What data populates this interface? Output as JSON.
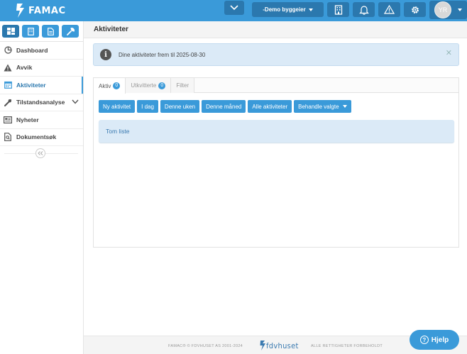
{
  "header": {
    "logo_text": "FAMAC",
    "tenant_label": "-Demo byggeier",
    "user_initials": "YR"
  },
  "sidebar": {
    "tabs": [
      "dashboard-grid-icon",
      "building-icon",
      "document-icon",
      "wrench-icon"
    ],
    "items": [
      {
        "label": "Dashboard",
        "icon": "pie-chart-icon"
      },
      {
        "label": "Avvik",
        "icon": "warning-icon"
      },
      {
        "label": "Aktiviteter",
        "icon": "calendar-icon",
        "active": true
      },
      {
        "label": "Tilstandsanalyse",
        "icon": "wrench-icon",
        "expandable": true
      },
      {
        "label": "Nyheter",
        "icon": "newspaper-icon"
      },
      {
        "label": "Dokumentsøk",
        "icon": "file-search-icon"
      }
    ]
  },
  "main": {
    "page_title": "Aktiviteter",
    "alert_text": "Dine aktiviteter frem til 2025-08-30",
    "tabs": [
      {
        "label": "Aktiv",
        "badge": "0"
      },
      {
        "label": "Utkvitterte",
        "badge": "0"
      },
      {
        "label": "Filter",
        "badge": ""
      }
    ],
    "buttons": {
      "new_activity": "Ny aktivitet",
      "today": "I dag",
      "this_week": "Denne uken",
      "this_month": "Denne måned",
      "all_activities": "Alle aktiviteter",
      "handle_selected": "Behandle valgte"
    },
    "empty_text": "Tom liste"
  },
  "footer": {
    "left_text": "FAMAC® © FDVHUSET AS 2001-2024",
    "logo_text": "fdvhuset",
    "right_text": "ALLE RETTIGHETER FORBEHOLDT"
  },
  "help": {
    "label": "Hjelp"
  },
  "colors": {
    "primary": "#3a9ad9",
    "primary_dark": "#2b78ae",
    "info_bg": "#dbeaf7"
  }
}
